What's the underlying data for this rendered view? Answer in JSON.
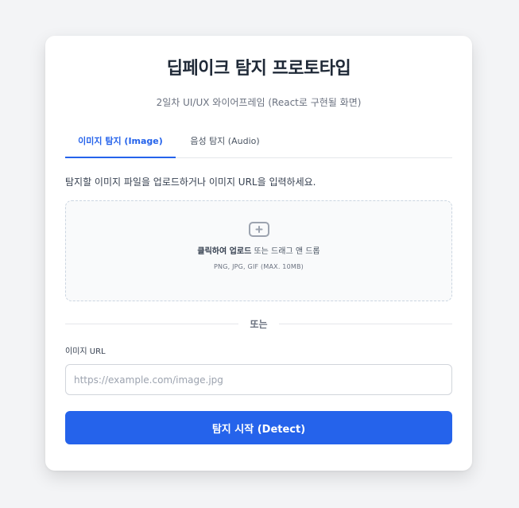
{
  "header": {
    "title": "딥페이크 탐지 프로토타입",
    "subtitle": "2일차 UI/UX 와이어프레임 (React로 구현될 화면)"
  },
  "tabs": [
    {
      "label": "이미지 탐지 (Image)",
      "active": true
    },
    {
      "label": "음성 탐지 (Audio)",
      "active": false
    }
  ],
  "instruction": "탐지할 이미지 파일을 업로드하거나 이미지 URL을 입력하세요.",
  "dropzone": {
    "icon": "image-upload-icon",
    "action_bold": "클릭하여 업로드",
    "action_rest": " 또는 드래그 앤 드롭",
    "hint": "PNG, JPG, GIF (MAX. 10MB)"
  },
  "divider_text": "또는",
  "url_field": {
    "label": "이미지 URL",
    "placeholder": "https://example.com/image.jpg",
    "value": ""
  },
  "detect_button": "탐지 시작 (Detect)",
  "colors": {
    "accent": "#2563eb",
    "background": "#f3f4f6",
    "card": "#ffffff"
  }
}
